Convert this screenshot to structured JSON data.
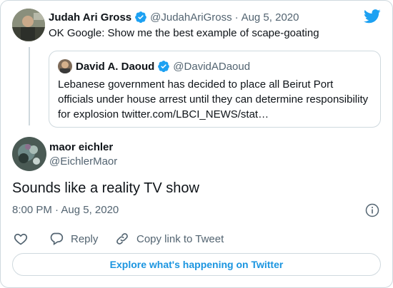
{
  "parent_tweet": {
    "display_name": "Judah Ari Gross",
    "handle": "@JudahAriGross",
    "separator": "·",
    "date": "Aug 5, 2020",
    "text": "OK Google: Show me the best example of scape-goating"
  },
  "quoted_tweet": {
    "display_name": "David A. Daoud",
    "handle": "@DavidADaoud",
    "text_line1": "Lebanese government has decided to place all Beirut Port",
    "text_line2": "officials under house arrest until they can determine responsibility",
    "text_line3": "for explosion twitter.com/LBCI_NEWS/stat…"
  },
  "main_tweet": {
    "display_name": "maor eichler",
    "handle": "@EichlerMaor",
    "text": "Sounds like a reality TV show",
    "timestamp": "8:00 PM · Aug 5, 2020"
  },
  "actions": {
    "reply_label": "Reply",
    "copy_link_label": "Copy link to Tweet"
  },
  "footer": {
    "explore_label": "Explore what's happening on Twitter"
  },
  "colors": {
    "brand_blue": "#1da1f2",
    "link_blue": "#1b95e0",
    "text_dark": "#0f1419",
    "text_muted": "#536471",
    "border": "#cfd9de"
  }
}
